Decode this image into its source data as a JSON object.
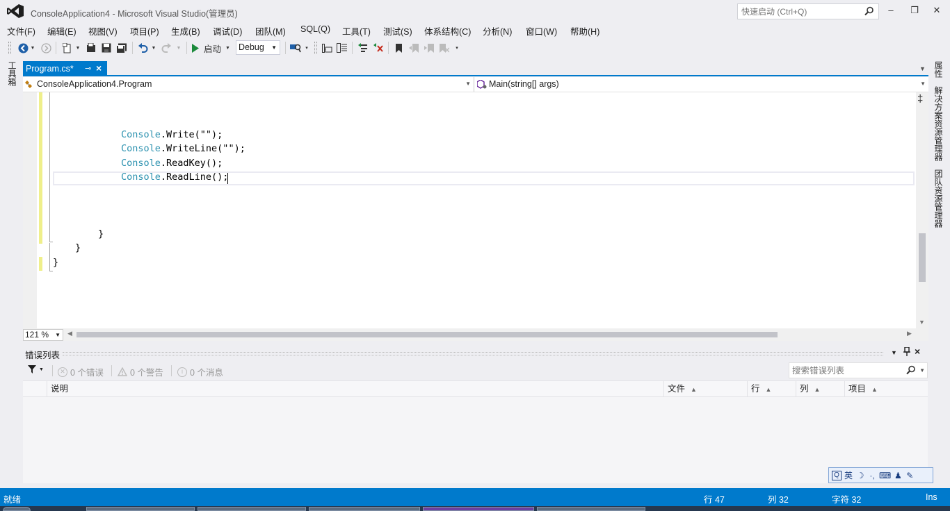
{
  "window": {
    "title": "ConsoleApplication4 - Microsoft Visual Studio(管理员)",
    "quick_launch_placeholder": "快速启动 (Ctrl+Q)"
  },
  "menu": [
    {
      "label": "文件(F)"
    },
    {
      "label": "编辑(E)"
    },
    {
      "label": "视图(V)"
    },
    {
      "label": "项目(P)"
    },
    {
      "label": "生成(B)"
    },
    {
      "label": "调试(D)"
    },
    {
      "label": "团队(M)"
    },
    {
      "label": "SQL(Q)"
    },
    {
      "label": "工具(T)"
    },
    {
      "label": "测试(S)"
    },
    {
      "label": "体系结构(C)"
    },
    {
      "label": "分析(N)"
    },
    {
      "label": "窗口(W)"
    },
    {
      "label": "帮助(H)"
    }
  ],
  "toolbar": {
    "start_label": "启动",
    "config_value": "Debug"
  },
  "side_tabs": {
    "left": "工具箱",
    "right": [
      "属性",
      "解决方案资源管理器",
      "团队资源管理器"
    ]
  },
  "document": {
    "tab_label": "Program.cs*",
    "nav_class": "ConsoleApplication4.Program",
    "nav_member": "Main(string[] args)",
    "code": [
      {
        "indent": "            ",
        "obj": "Console",
        "rest": ".Write(\"\");"
      },
      {
        "indent": "            ",
        "obj": "Console",
        "rest": ".WriteLine(\"\");"
      },
      {
        "indent": "            ",
        "obj": "Console",
        "rest": ".ReadKey();"
      },
      {
        "indent": "            ",
        "obj": "Console",
        "rest": ".ReadLine();"
      }
    ],
    "brace1": "}",
    "brace2": "}",
    "brace3": "}",
    "zoom": "121 %"
  },
  "error_list": {
    "title": "错误列表",
    "errors": "0 个错误",
    "warnings": "0 个警告",
    "messages": "0 个消息",
    "search_placeholder": "搜索错误列表",
    "columns": [
      "说明",
      "文件",
      "行",
      "列",
      "项目"
    ]
  },
  "ime": {
    "mode": "英"
  },
  "status": {
    "state": "就绪",
    "line": "行 47",
    "col": "列 32",
    "char": "字符 32",
    "ins": "Ins"
  },
  "colors": {
    "accent": "#007acc",
    "type_name": "#2b91af",
    "change_marker": "#efef8b"
  }
}
